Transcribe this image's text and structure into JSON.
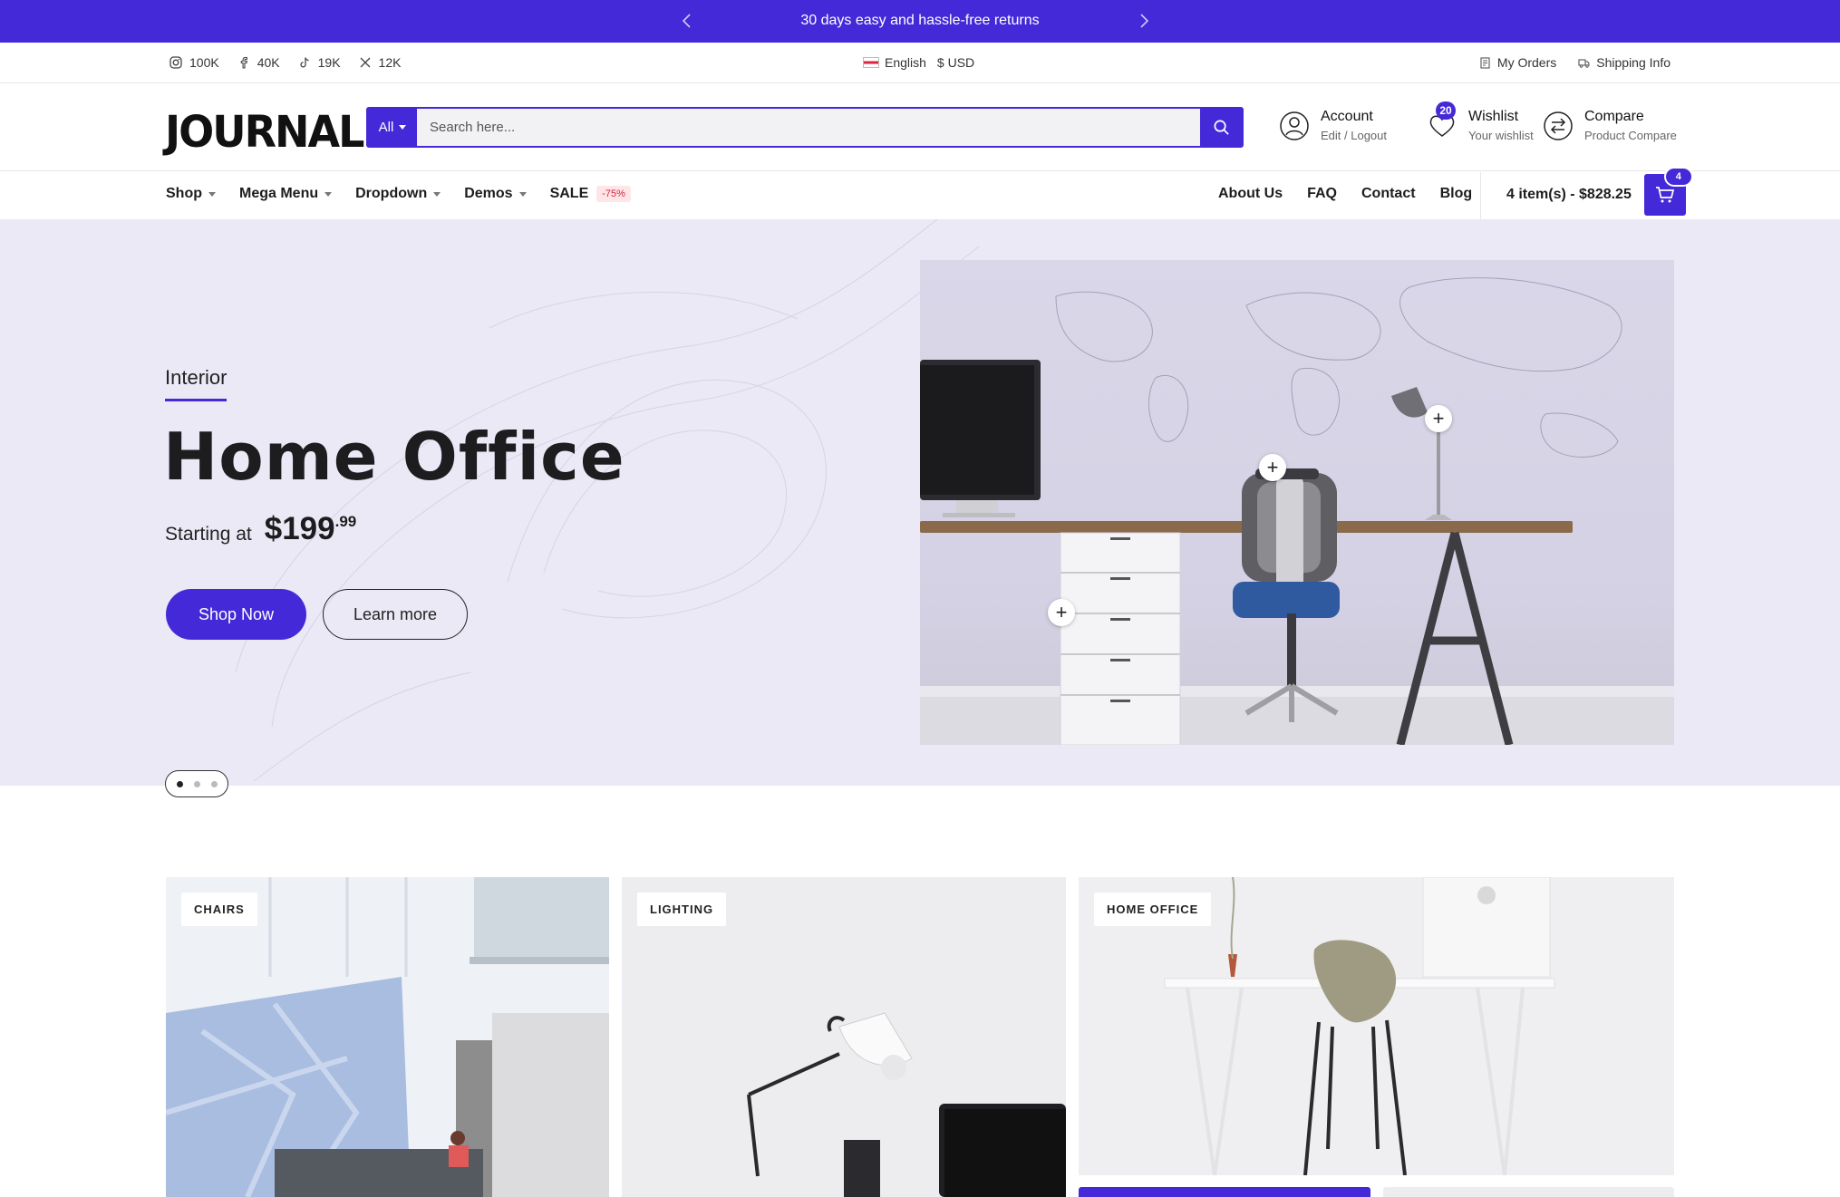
{
  "promo": {
    "text": "30 days easy and hassle-free returns",
    "prev_icon": "chevron-left-icon",
    "next_icon": "chevron-right-icon",
    "background": "#4429d8"
  },
  "utility": {
    "social": [
      {
        "icon": "instagram-icon",
        "count": "100K"
      },
      {
        "icon": "facebook-icon",
        "count": "40K"
      },
      {
        "icon": "tiktok-icon",
        "count": "19K"
      },
      {
        "icon": "x-icon",
        "count": "12K"
      }
    ],
    "language": "English",
    "currency": "$ USD",
    "links": [
      {
        "icon": "orders-icon",
        "label": "My Orders"
      },
      {
        "icon": "truck-icon",
        "label": "Shipping Info"
      }
    ]
  },
  "header": {
    "logo": "JOURNAL",
    "search": {
      "category": "All",
      "placeholder": "Search here..."
    },
    "account": {
      "label": "Account",
      "sub": "Edit / Logout"
    },
    "wishlist": {
      "label": "Wishlist",
      "sub": "Your wishlist",
      "count": "20"
    },
    "compare": {
      "label": "Compare",
      "sub": "Product Compare"
    }
  },
  "nav": {
    "left": [
      {
        "label": "Shop",
        "dropdown": true
      },
      {
        "label": "Mega Menu",
        "dropdown": true
      },
      {
        "label": "Dropdown",
        "dropdown": true
      },
      {
        "label": "Demos",
        "dropdown": true
      }
    ],
    "sale": {
      "label": "SALE",
      "badge": "-75%"
    },
    "right": [
      "About Us",
      "FAQ",
      "Contact",
      "Blog"
    ],
    "cart": {
      "summary": "4 item(s) - $828.25",
      "count": "4"
    }
  },
  "hero": {
    "eyebrow": "Interior",
    "title": "Home Office",
    "price_prefix": "Starting at",
    "price": "$199",
    "price_cents": ".99",
    "primary_button": "Shop Now",
    "secondary_button": "Learn more",
    "slides": 3,
    "active_slide": 1
  },
  "categories": [
    {
      "label": "CHAIRS"
    },
    {
      "label": "LIGHTING"
    },
    {
      "label": "HOME OFFICE"
    }
  ],
  "colors": {
    "accent": "#4429d8",
    "hero_bg": "#ebe9f6",
    "sale": "#d7263d"
  }
}
